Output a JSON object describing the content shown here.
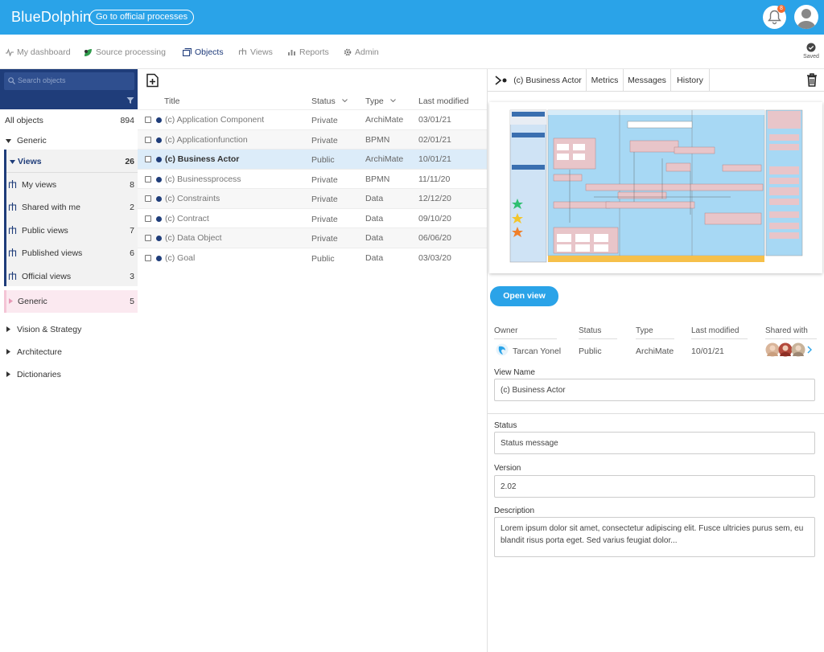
{
  "app": {
    "name": "BlueDolphin",
    "official_btn": "Go to official processes",
    "notification_count": "8",
    "accent": "#2aa3e8",
    "navy": "#1f3d7a"
  },
  "nav": {
    "items": [
      {
        "label": "My dashboard",
        "icon": "pulse-icon"
      },
      {
        "label": "Source processing",
        "icon": "leaf-icon"
      },
      {
        "label": "Objects",
        "icon": "cube-icon"
      },
      {
        "label": "Views",
        "icon": "hierarchy-icon"
      },
      {
        "label": "Reports",
        "icon": "bar-chart-icon"
      },
      {
        "label": "Admin",
        "icon": "gear-icon"
      }
    ],
    "saved": "Saved"
  },
  "sidebar": {
    "search_placeholder": "Search objects",
    "all_objects": {
      "label": "All objects",
      "count": "894"
    },
    "generic": "Generic",
    "views": {
      "label": "Views",
      "count": "26"
    },
    "view_items": [
      {
        "label": "My views",
        "count": "8"
      },
      {
        "label": "Shared with me",
        "count": "2"
      },
      {
        "label": "Public views",
        "count": "7"
      },
      {
        "label": "Published views",
        "count": "6"
      },
      {
        "label": "Official views",
        "count": "3"
      }
    ],
    "generic_sub": {
      "label": "Generic",
      "count": "5"
    },
    "groups": [
      "Vision & Strategy",
      "Architecture",
      "Dictionaries"
    ]
  },
  "table": {
    "columns": [
      "Title",
      "Status",
      "Type",
      "Last modified"
    ],
    "rows": [
      {
        "title": "(c) Application Component",
        "status": "Private",
        "type": "ArchiMate",
        "modified": "03/01/21"
      },
      {
        "title": "(c) Applicationfunction",
        "status": "Private",
        "type": "BPMN",
        "modified": "02/01/21"
      },
      {
        "title": "(c) Business Actor",
        "status": "Public",
        "type": "ArchiMate",
        "modified": "10/01/21"
      },
      {
        "title": "(c) Businessprocess",
        "status": "Private",
        "type": "BPMN",
        "modified": "11/11/20"
      },
      {
        "title": "(c) Constraints",
        "status": "Private",
        "type": "Data",
        "modified": "12/12/20"
      },
      {
        "title": "(c) Contract",
        "status": "Private",
        "type": "Data",
        "modified": "09/10/20"
      },
      {
        "title": "(c) Data Object",
        "status": "Private",
        "type": "Data",
        "modified": "06/06/20"
      },
      {
        "title": "(c) Goal",
        "status": "Public",
        "type": "Data",
        "modified": "03/03/20"
      }
    ]
  },
  "detail": {
    "tabs": [
      "(c) Business Actor",
      "Metrics",
      "Messages",
      "History"
    ],
    "open_view": "Open view",
    "meta_headers": [
      "Owner",
      "Status",
      "Type",
      "Last modified",
      "Shared with"
    ],
    "meta_values": {
      "owner": "Tarcan Yonel",
      "status": "Public",
      "type": "ArchiMate",
      "modified": "10/01/21"
    },
    "view_name_label": "View Name",
    "view_name": "(c) Business Actor",
    "status_label": "Status",
    "status_value": "Status message",
    "version_label": "Version",
    "version_value": "2.02",
    "description_label": "Description",
    "description_value": "Lorem ipsum dolor sit amet, consectetur adipiscing elit. Fusce ultricies purus sem, eu blandit risus porta eget. Sed varius feugiat dolor..."
  }
}
